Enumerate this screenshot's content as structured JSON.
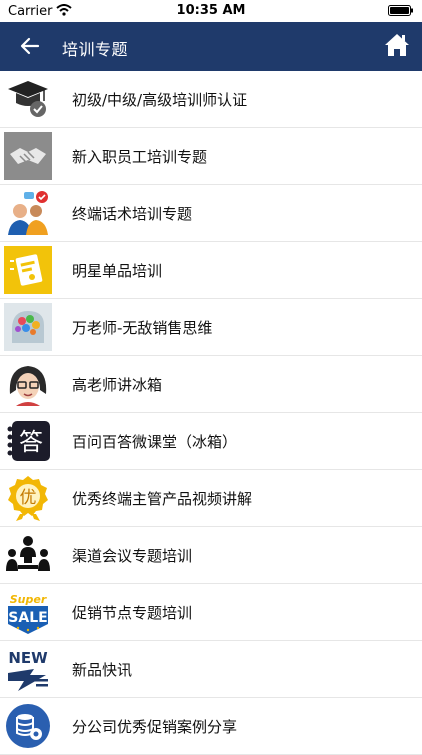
{
  "status": {
    "carrier": "Carrier",
    "time": "10:35 AM"
  },
  "nav": {
    "title": "培训专题"
  },
  "items": [
    {
      "label": "初级/中级/高级培训师认证",
      "icon": "graduation-cap-icon"
    },
    {
      "label": "新入职员工培训专题",
      "icon": "handshake-icon"
    },
    {
      "label": "终端话术培训专题",
      "icon": "people-chat-icon"
    },
    {
      "label": "明星单品培训",
      "icon": "product-card-icon"
    },
    {
      "label": "万老师-无敌销售思维",
      "icon": "brain-icon"
    },
    {
      "label": "高老师讲冰箱",
      "icon": "teacher-avatar-icon"
    },
    {
      "label": "百问百答微课堂（冰箱）",
      "icon": "answer-badge-icon"
    },
    {
      "label": "优秀终端主管产品视频讲解",
      "icon": "excellence-medal-icon"
    },
    {
      "label": "渠道会议专题培训",
      "icon": "meeting-icon"
    },
    {
      "label": "促销节点专题培训",
      "icon": "sale-badge-icon"
    },
    {
      "label": "新品快讯",
      "icon": "new-flash-icon"
    },
    {
      "label": "分公司优秀促销案例分享",
      "icon": "database-gear-icon"
    }
  ],
  "thumb_text": {
    "answer": "答",
    "excellence": "优",
    "sale_top": "Super",
    "sale_main": "SALE",
    "new": "NEW"
  }
}
